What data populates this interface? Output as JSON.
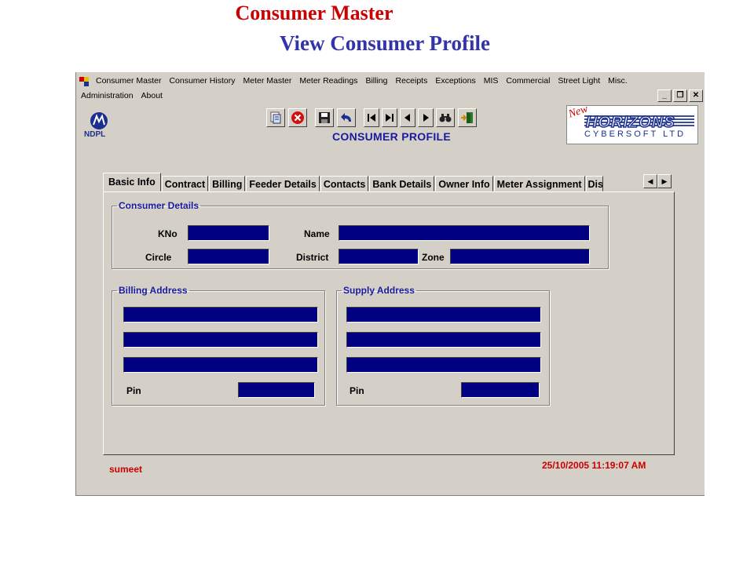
{
  "slide": {
    "title": "Consumer Master",
    "subtitle": "View Consumer Profile",
    "title_color": "#cc0000",
    "subtitle_color": "#3333aa"
  },
  "menu": {
    "row1": [
      "Consumer Master",
      "Consumer History",
      "Meter Master",
      "Meter Readings",
      "Billing",
      "Receipts",
      "Exceptions",
      "MIS",
      "Commercial",
      "Street Light",
      "Misc."
    ],
    "row2": [
      "Administration",
      "About"
    ]
  },
  "window_buttons": {
    "minimize": "_",
    "restore": "❐",
    "close": "✕"
  },
  "toolbar": {
    "icons": [
      "print-icon",
      "cancel-icon",
      "save-icon",
      "undo-icon",
      "first-record-icon",
      "last-record-icon",
      "previous-record-icon",
      "next-record-icon",
      "find-icon",
      "exit-icon"
    ]
  },
  "logo": {
    "left_text": "NDPL",
    "brand_new": "New",
    "brand_main": "HORIZONS",
    "brand_sub": "CYBERSOFT LTD"
  },
  "heading": "CONSUMER PROFILE",
  "tabs": {
    "items": [
      "Basic Info",
      "Contract",
      "Billing",
      "Feeder Details",
      "Contacts",
      "Bank Details",
      "Owner Info",
      "Meter Assignment",
      "Dis"
    ],
    "active": "Basic Info"
  },
  "consumer_details": {
    "legend": "Consumer Details",
    "kno_label": "KNo",
    "name_label": "Name",
    "circle_label": "Circle",
    "district_label": "District",
    "zone_label": "Zone"
  },
  "billing_address": {
    "legend": "Billing Address",
    "pin_label": "Pin"
  },
  "supply_address": {
    "legend": "Supply Address",
    "pin_label": "Pin"
  },
  "status": {
    "user": "sumeet",
    "datetime": "25/10/2005 11:19:07 AM",
    "color": "#cc0000"
  },
  "colors": {
    "field_bg": "#000080",
    "window_bg": "#d4d0c8",
    "legend": "#1a1aa0"
  }
}
